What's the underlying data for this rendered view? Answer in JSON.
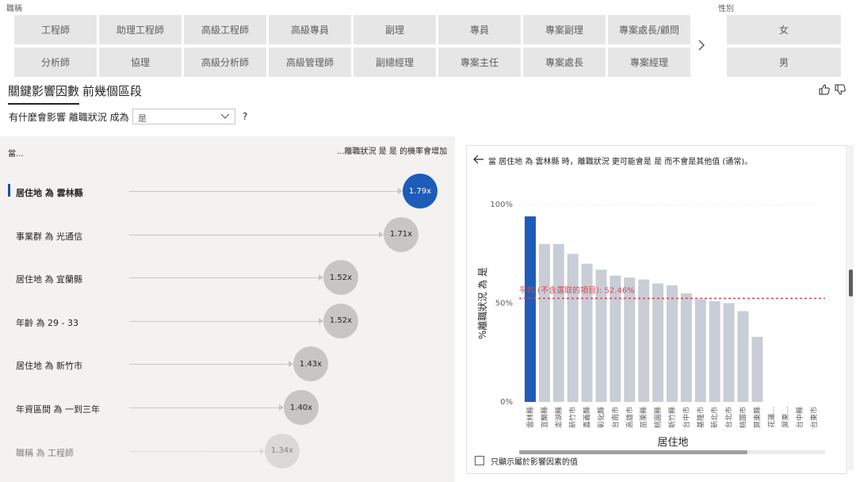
{
  "job_slicer": {
    "title": "職稱",
    "items": [
      "工程師",
      "助理工程師",
      "高級工程師",
      "高級專員",
      "副理",
      "專員",
      "專案副理",
      "專案處長/顧問",
      "分析師",
      "協理",
      "高級分析師",
      "高級管理師",
      "副總經理",
      "專案主任",
      "專案處長",
      "專案經理"
    ]
  },
  "gender_slicer": {
    "title": "性別",
    "items": [
      "女",
      "男"
    ]
  },
  "tabs": [
    "關鍵影響因數",
    "前幾個區段"
  ],
  "question": {
    "prefix": "有什麼會影響 離職狀況 成為",
    "selected": "是",
    "suffix": "?"
  },
  "left": {
    "header_left": "當...",
    "header_right": "...離職狀況 是 是 的機率會增加",
    "factors": [
      {
        "label": "居住地 為 雲林縣",
        "value": "1.79x"
      },
      {
        "label": "事業群 為 光通信",
        "value": "1.71x"
      },
      {
        "label": "居住地 為 宜蘭縣",
        "value": "1.52x"
      },
      {
        "label": "年齡 為 29 - 33",
        "value": "1.52x"
      },
      {
        "label": "居住地 為 新竹市",
        "value": "1.43x"
      },
      {
        "label": "年資區間 為 一到三年",
        "value": "1.40x"
      },
      {
        "label": "職稱 為 工程師",
        "value": "1.34x"
      }
    ]
  },
  "right": {
    "title": "當 居住地 為 雲林縣 時，離職狀況 更可能會是 是 而不會是其他值 (通常)。",
    "checkbox_label": "只顯示屬於影響因素的值"
  },
  "chart_data": {
    "type": "bar",
    "xlabel": "居住地",
    "ylabel": "%離職狀況 為 是",
    "ylim": [
      0,
      100
    ],
    "y_ticks": [
      "0%",
      "50%",
      "100%"
    ],
    "average_label": "平均 (不含選取的項目): 52.46%",
    "average_value": 52.46,
    "highlight_color": "#1e5cba",
    "bar_color": "#c8cdd6",
    "avg_color": "#d64550",
    "categories": [
      "雲林縣",
      "宜蘭縣",
      "澎湖縣",
      "新竹市",
      "嘉義縣",
      "彰化縣",
      "台南市",
      "高雄市",
      "苗栗縣",
      "桃園縣",
      "新竹縣",
      "台中市",
      "基隆市",
      "新北市",
      "台北市",
      "桃園市",
      "屏東縣",
      "花蓮...",
      "屏東...",
      "台中縣",
      "台東市"
    ],
    "values": [
      94,
      80,
      80,
      75,
      70,
      67,
      64,
      63,
      62,
      60,
      59,
      55,
      52,
      51,
      50,
      46,
      33,
      0,
      0,
      0,
      0
    ]
  }
}
